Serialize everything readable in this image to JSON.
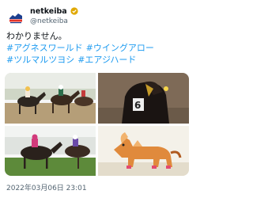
{
  "tweet": {
    "author_name": "netkeiba",
    "author_handle": "@netkeiba",
    "verified_badge_color": "#e0a800",
    "text": "わかりません。",
    "hashtags": [
      "#アグネスワールド",
      "#ウイングアロー",
      "#ツルマルツヨシ",
      "#エアジハード"
    ],
    "timestamp": "2022年03月06日 23:01",
    "media": [
      {
        "icon": "horse-race-photo"
      },
      {
        "icon": "horse-portrait-photo"
      },
      {
        "icon": "horse-race-finish-photo"
      },
      {
        "icon": "horse-illustration-photo"
      }
    ]
  },
  "colors": {
    "hashtag": "#1d9bf0",
    "text": "#0f1419",
    "secondary": "#536471"
  }
}
